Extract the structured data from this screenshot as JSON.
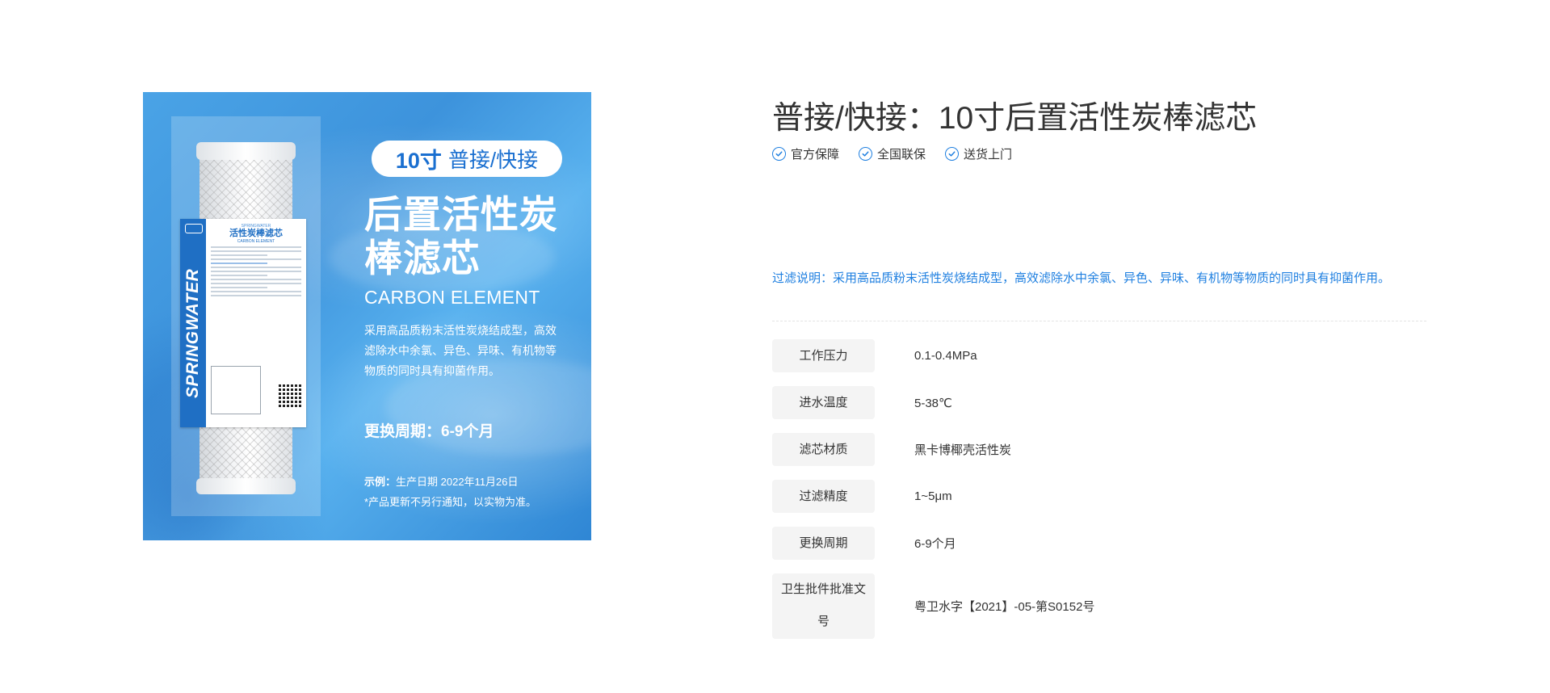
{
  "product_image": {
    "badge_size": "10寸",
    "badge_connection": "普接/快接",
    "headline_line1": "后置活性炭",
    "headline_line2": "棒滤芯",
    "english_title": "CARBON ELEMENT",
    "description": "采用高品质粉末活性炭烧结成型，高效滤除水中余氯、异色、异味、有机物等物质的同时具有抑菌作用。",
    "replace_cycle": "更换周期：6-9个月",
    "example_label": "示例：",
    "example_text": "生产日期 2022年11月26日",
    "note": "*产品更新不另行通知，以实物为准。",
    "label_brand": "SPRINGWATER",
    "label_title": "活性炭棒滤芯",
    "label_subtitle": "CARBON ELEMENT",
    "label_vertical_text": "SPRINGWATER"
  },
  "product": {
    "title": "普接/快接：10寸后置活性炭棒滤芯",
    "guarantees": [
      {
        "label": "官方保障",
        "icon": "check-circle-icon"
      },
      {
        "label": "全国联保",
        "icon": "check-circle-icon"
      },
      {
        "label": "送货上门",
        "icon": "check-circle-icon"
      }
    ],
    "filter_description": "过滤说明：采用高品质粉末活性炭烧结成型，高效滤除水中余氯、异色、异味、有机物等物质的同时具有抑菌作用。",
    "specs": [
      {
        "label": "工作压力",
        "value": "0.1-0.4MPa"
      },
      {
        "label": "进水温度",
        "value": "5-38℃"
      },
      {
        "label": "滤芯材质",
        "value": "黑卡博椰壳活性炭"
      },
      {
        "label": "过滤精度",
        "value": "1~5μm"
      },
      {
        "label": "更换周期",
        "value": "6-9个月"
      },
      {
        "label": "卫生批件批准文号",
        "value": "粤卫水字【2021】-05-第S0152号"
      }
    ]
  },
  "colors": {
    "accent_blue": "#1e7fe0",
    "spec_label_bg": "#f4f4f4",
    "text": "#333333",
    "image_bg": "#3d93dc"
  }
}
